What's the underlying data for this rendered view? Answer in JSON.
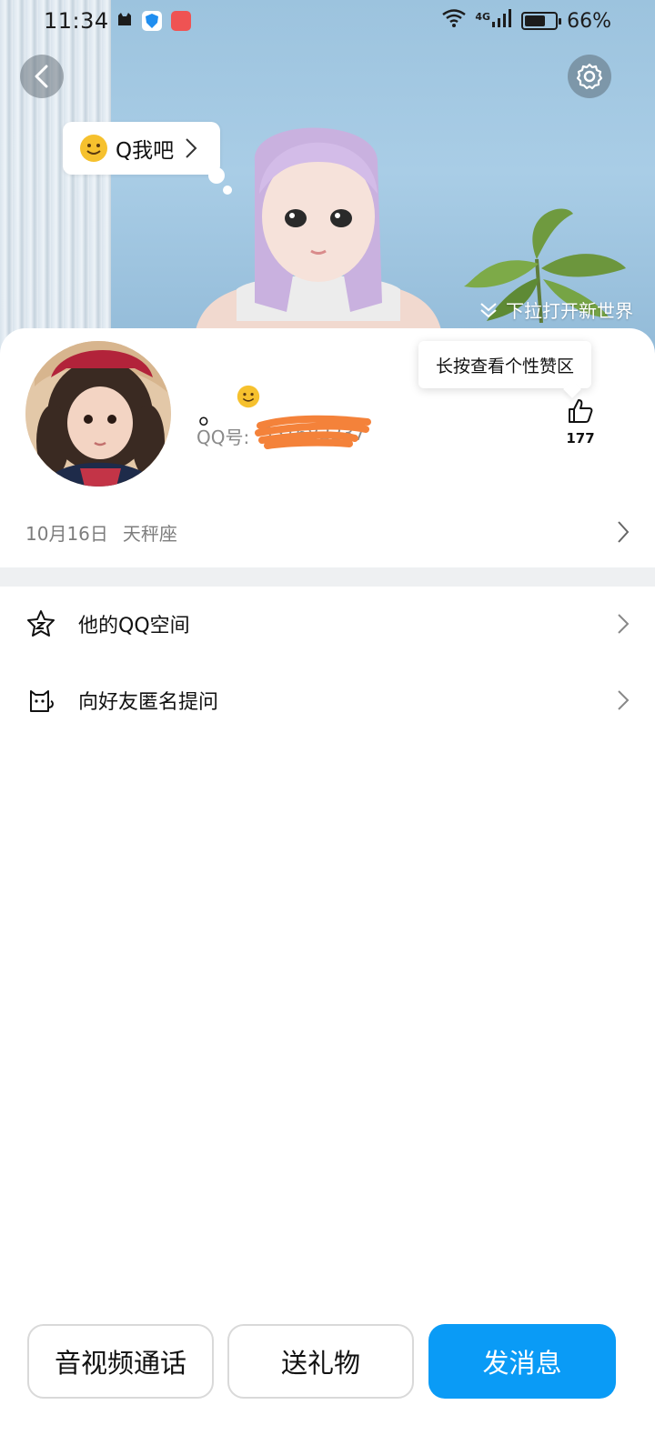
{
  "status_bar": {
    "time": "11:34",
    "network": "4G",
    "battery_percent": "66%",
    "battery_level": 0.66,
    "notification_icons": [
      "cat-app-icon",
      "security-shield-icon",
      "red-app-icon"
    ]
  },
  "header": {
    "bubble_text": "Q我吧",
    "pull_hint": "下拉打开新世界",
    "back_icon": "back-arrow-icon",
    "settings_icon": "gear-icon"
  },
  "profile": {
    "nickname": "。",
    "qq_label": "QQ号:",
    "qq_number": "551682237",
    "tooltip": "长按查看个性赞区",
    "like_count": "177",
    "birthday": "10月16日",
    "zodiac": "天秤座"
  },
  "menu": [
    {
      "label": "他的QQ空间",
      "icon": "qzone-star-icon"
    },
    {
      "label": "向好友匿名提问",
      "icon": "anonymous-cat-icon"
    }
  ],
  "actions": {
    "call": "音视频通话",
    "gift": "送礼物",
    "message": "发消息"
  },
  "colors": {
    "primary_button": "#0a9bf6",
    "redaction": "#f4823a",
    "separator": "#eef0f2"
  }
}
